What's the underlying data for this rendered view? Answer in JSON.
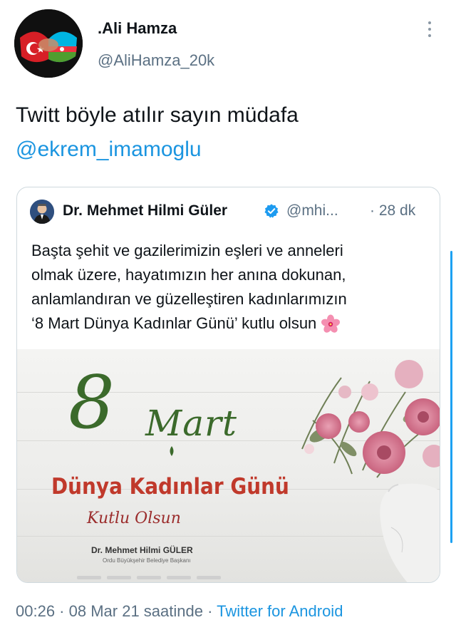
{
  "tweet": {
    "author": {
      "name": ".Ali Hamza",
      "handle": "@AliHamza_20k"
    },
    "text_line1": "Twitt böyle atılır sayın müdafa",
    "mention": "@ekrem_imamoglu",
    "meta": {
      "time": "00:26",
      "separator1": " · ",
      "date": "08 Mar 21 saatinde",
      "separator2": " · ",
      "source_app": "Twitter for Android"
    }
  },
  "quoted_tweet": {
    "author": {
      "name": "Dr. Mehmet Hilmi Güler",
      "handle": "@mhi...",
      "verified": true
    },
    "time": "· 28 dk",
    "text_lines": [
      "Başta şehit ve gazilerimizin eşleri ve anneleri",
      "olmak üzere, hayatımızın her anına dokunan,",
      "anlamlandıran ve güzelleştiren kadınlarımızın",
      "‘8 Mart Dünya Kadınlar Günü’ kutlu olsun"
    ],
    "emoji_icon": "flower-emoji",
    "poster": {
      "eight": "8",
      "mart": "Mart",
      "day_title": "Dünya Kadınlar Günü",
      "kutlu": "Kutlu Olsun",
      "signature_name": "Dr. Mehmet Hilmi GÜLER",
      "signature_title": "Ordu Büyükşehir Belediye Başkanı"
    }
  },
  "colors": {
    "link": "#1b95e0",
    "secondary_text": "#5b7083",
    "verified": "#1d9bf0",
    "poster_green": "#3b6a2b",
    "poster_red": "#c0392b"
  }
}
